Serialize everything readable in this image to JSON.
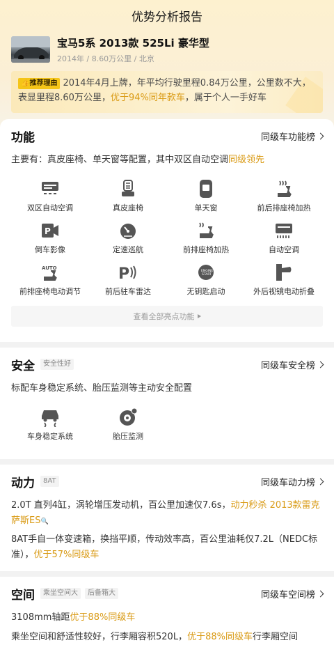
{
  "header": {
    "title": "优势分析报告"
  },
  "car": {
    "name": "宝马5系 2013款 525Li 豪华型",
    "meta": "2014年 / 8.60万公里 / 北京"
  },
  "recommend": {
    "badge": "推荐理由",
    "text_a": "2014年4月上牌，年平均行驶里程0.84万公里，公里数不大，表显里程8.60万公里，",
    "text_hl": "优于94%同年款车",
    "text_b": "，属于个人一手好车"
  },
  "function": {
    "title": "功能",
    "link": "同级车功能榜",
    "desc_a": "主要有：真皮座椅、单天窗等配置，其中双区自动空调",
    "desc_hl": "同级领先",
    "features": [
      {
        "icon": "dual-zone-ac-icon",
        "label": "双区自动空调"
      },
      {
        "icon": "leather-seat-icon",
        "label": "真皮座椅"
      },
      {
        "icon": "sunroof-icon",
        "label": "单天窗"
      },
      {
        "icon": "seat-heating-icon",
        "label": "前后排座椅加热"
      },
      {
        "icon": "reverse-camera-icon",
        "label": "倒车影像"
      },
      {
        "icon": "cruise-control-icon",
        "label": "定速巡航"
      },
      {
        "icon": "front-seat-heating-icon",
        "label": "前排座椅加热"
      },
      {
        "icon": "auto-ac-icon",
        "label": "自动空调"
      },
      {
        "icon": "power-seat-icon",
        "label": "前排座椅电动调节"
      },
      {
        "icon": "parking-radar-icon",
        "label": "前后驻车雷达"
      },
      {
        "icon": "keyless-start-icon",
        "label": "无钥匙启动"
      },
      {
        "icon": "mirror-fold-icon",
        "label": "外后视镜电动折叠"
      }
    ],
    "view_all": "查看全部亮点功能"
  },
  "safety": {
    "title": "安全",
    "tag": "安全性好",
    "link": "同级车安全榜",
    "desc": "标配车身稳定系统、胎压监测等主动安全配置",
    "features": [
      {
        "icon": "stability-control-icon",
        "label": "车身稳定系统"
      },
      {
        "icon": "tire-pressure-icon",
        "label": "胎压监测"
      }
    ]
  },
  "power": {
    "title": "动力",
    "tag": "8AT",
    "link": "同级车动力榜",
    "p1_a": "2.0T 直列4缸，涡轮增压发动机，百公里加速仅7.6s，",
    "p1_hl": "动力秒杀 2013款雷克萨斯ES",
    "p2_a": "8AT手自一体变速箱，换挡平顺，传动效率高，百公里油耗仅7.2L（NEDC标准），",
    "p2_hl": "优于57%同级车"
  },
  "space": {
    "title": "空间",
    "tag1": "乘坐空间大",
    "tag2": "后备箱大",
    "link": "同级车空间榜",
    "p1_a": "3108mm轴距",
    "p1_hl": "优于88%同级车",
    "p2_a": "乘坐空间和舒适性较好，行李厢容积520L，",
    "p2_hl": "优于88%同级车",
    "p2_b": "行李厢空间"
  },
  "colors": {
    "highlight": "#d99a14",
    "badge": "#f5c518"
  }
}
